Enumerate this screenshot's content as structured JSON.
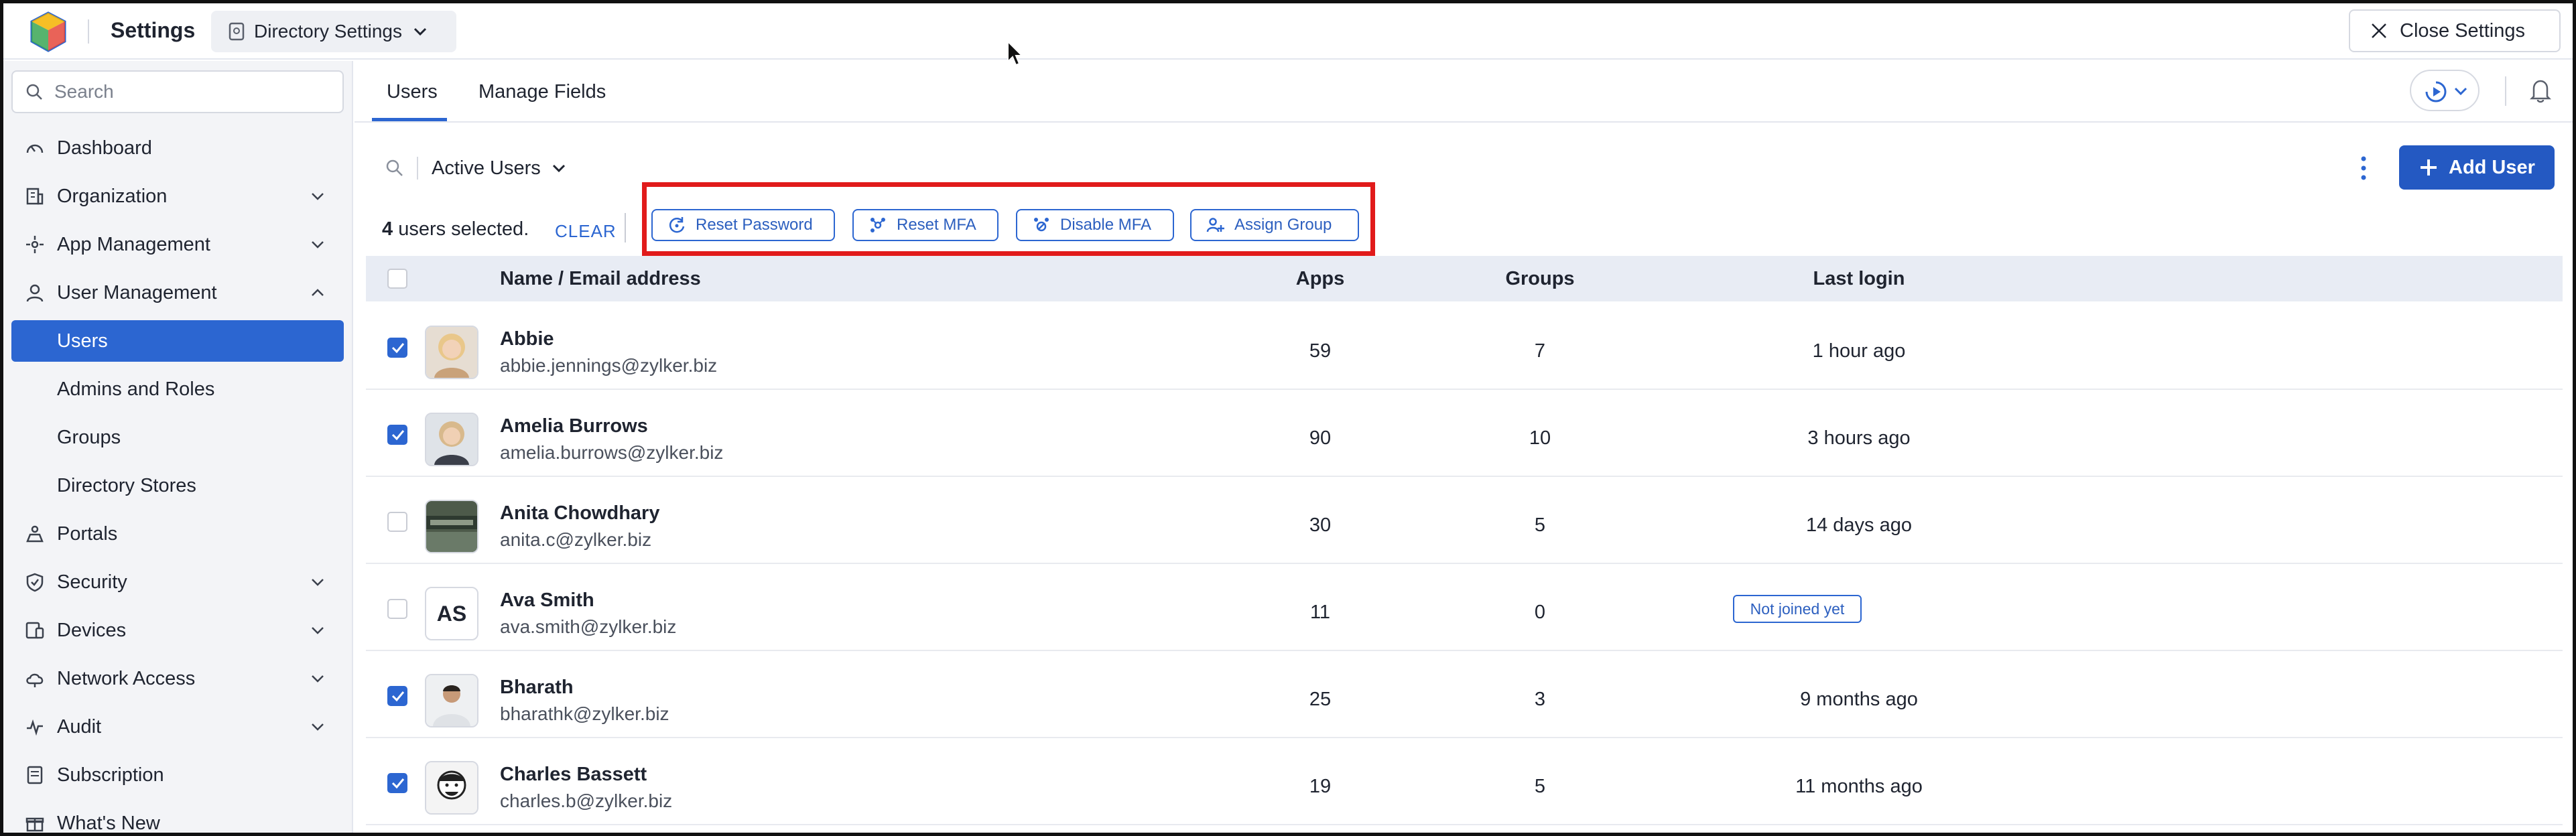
{
  "header": {
    "app_title": "Settings",
    "directory_label": "Directory Settings",
    "close_label": "Close Settings"
  },
  "sidebar": {
    "search_placeholder": "Search",
    "items": [
      {
        "label": "Dashboard",
        "icon": "gauge-icon"
      },
      {
        "label": "Organization",
        "icon": "building-icon",
        "expandable": true
      },
      {
        "label": "App Management",
        "icon": "apps-icon",
        "expandable": true
      },
      {
        "label": "User Management",
        "icon": "user-icon",
        "expandable": true,
        "expanded": true
      },
      {
        "label": "Users",
        "sub": true,
        "active": true
      },
      {
        "label": "Admins and Roles",
        "sub": true
      },
      {
        "label": "Groups",
        "sub": true
      },
      {
        "label": "Directory Stores",
        "sub": true
      },
      {
        "label": "Portals",
        "icon": "portal-icon"
      },
      {
        "label": "Security",
        "icon": "shield-icon",
        "expandable": true
      },
      {
        "label": "Devices",
        "icon": "devices-icon",
        "expandable": true
      },
      {
        "label": "Network Access",
        "icon": "cloud-icon",
        "expandable": true
      },
      {
        "label": "Audit",
        "icon": "audit-icon",
        "expandable": true
      },
      {
        "label": "Subscription",
        "icon": "subscription-icon"
      },
      {
        "label": "What's New",
        "icon": "gift-icon"
      }
    ]
  },
  "tabs": [
    {
      "label": "Users",
      "active": true
    },
    {
      "label": "Manage Fields",
      "active": false
    }
  ],
  "toolbar": {
    "filter_label": "Active Users",
    "add_user_label": "Add User",
    "selected_count": "4",
    "selected_suffix": "users selected.",
    "clear_label": "CLEAR",
    "actions": [
      {
        "label": "Reset Password",
        "icon": "reset-password-icon"
      },
      {
        "label": "Reset MFA",
        "icon": "reset-mfa-icon"
      },
      {
        "label": "Disable MFA",
        "icon": "disable-mfa-icon"
      },
      {
        "label": "Assign Group",
        "icon": "assign-group-icon"
      }
    ]
  },
  "table": {
    "headers": {
      "name": "Name / Email address",
      "apps": "Apps",
      "groups": "Groups",
      "last_login": "Last login"
    },
    "rows": [
      {
        "name": "Abbie",
        "email": "abbie.jennings@zylker.biz",
        "apps": "59",
        "groups": "7",
        "last_login": "1 hour ago",
        "checked": true
      },
      {
        "name": "Amelia Burrows",
        "email": "amelia.burrows@zylker.biz",
        "apps": "90",
        "groups": "10",
        "last_login": "3 hours ago",
        "checked": true
      },
      {
        "name": "Anita Chowdhary",
        "email": "anita.c@zylker.biz",
        "apps": "30",
        "groups": "5",
        "last_login": "14 days ago",
        "checked": false
      },
      {
        "name": "Ava Smith",
        "email": "ava.smith@zylker.biz",
        "apps": "11",
        "groups": "0",
        "last_login": "Not joined yet",
        "checked": false,
        "initials": "AS"
      },
      {
        "name": "Bharath",
        "email": "bharathk@zylker.biz",
        "apps": "25",
        "groups": "3",
        "last_login": "9 months ago",
        "checked": true
      },
      {
        "name": "Charles Bassett",
        "email": "charles.b@zylker.biz",
        "apps": "19",
        "groups": "5",
        "last_login": "11 months ago",
        "checked": true
      }
    ]
  },
  "colors": {
    "accent": "#2c66d1",
    "highlight": "#e11b1b"
  }
}
